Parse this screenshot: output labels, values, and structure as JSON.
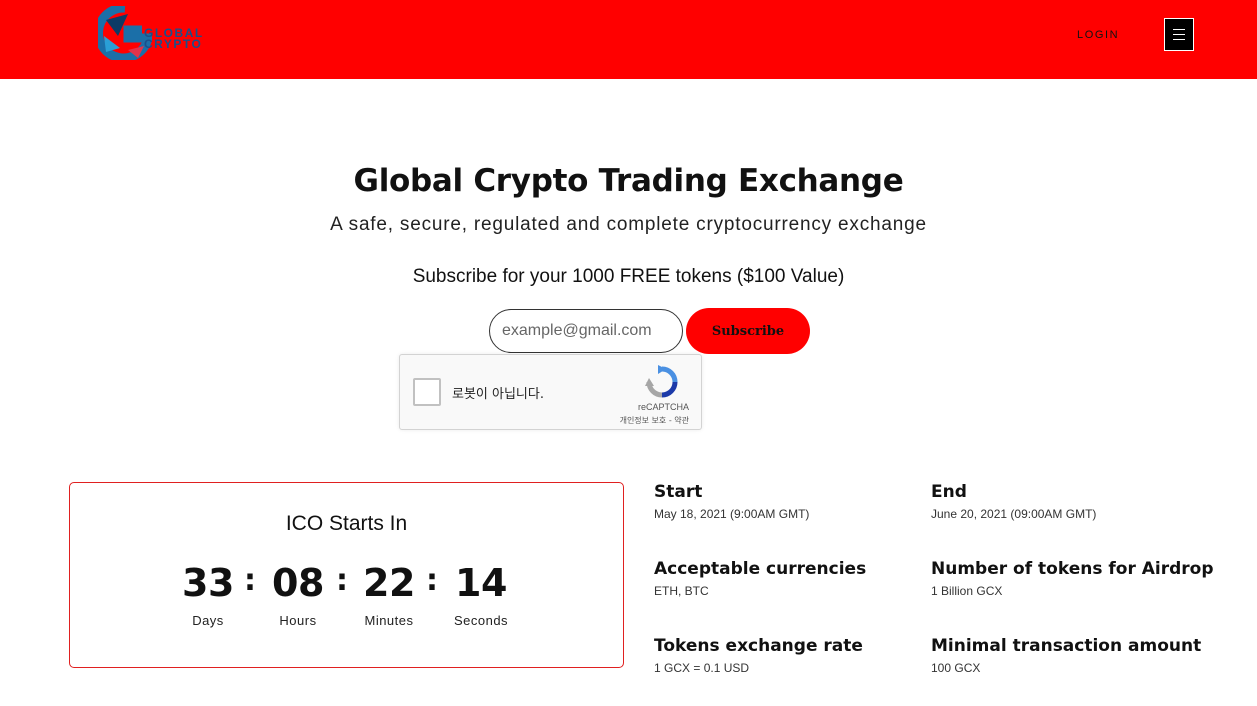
{
  "header": {
    "logo_line1": "GLOBAL",
    "logo_line2": "CRYPTO",
    "login_label": "LOGIN",
    "colors": {
      "bar": "#ff0000"
    },
    "menu_icon": "hamburger-menu-icon"
  },
  "hero": {
    "title": "Global Crypto Trading Exchange",
    "subtitle": "A safe, secure, regulated and complete cryptocurrency exchange",
    "subscribe_text": "Subscribe for your 1000 FREE tokens ($100 Value)",
    "email_placeholder": "example@gmail.com",
    "subscribe_button": "Subscribe"
  },
  "captcha": {
    "label": "로봇이 아닙니다.",
    "brand": "reCAPTCHA",
    "privacy": "개인정보 보호",
    "separator": " - ",
    "terms": "약관"
  },
  "countdown": {
    "title": "ICO Starts In",
    "units": [
      {
        "value": "33",
        "label": "Days"
      },
      {
        "value": "08",
        "label": "Hours"
      },
      {
        "value": "22",
        "label": "Minutes"
      },
      {
        "value": "14",
        "label": "Seconds"
      }
    ],
    "separator": ":"
  },
  "info": {
    "start": {
      "heading": "Start",
      "value": "May 18, 2021 (9:00AM GMT)"
    },
    "end": {
      "heading": "End",
      "value": "June 20, 2021 (09:00AM GMT)"
    },
    "currencies": {
      "heading": "Acceptable currencies",
      "value": "ETH, BTC"
    },
    "airdrop": {
      "heading": "Number of tokens for Airdrop",
      "value": "1 Billion GCX"
    },
    "rate": {
      "heading": "Tokens exchange rate",
      "value": "1 GCX = 0.1 USD"
    },
    "minimal": {
      "heading": "Minimal transaction amount",
      "value": "100 GCX"
    }
  }
}
